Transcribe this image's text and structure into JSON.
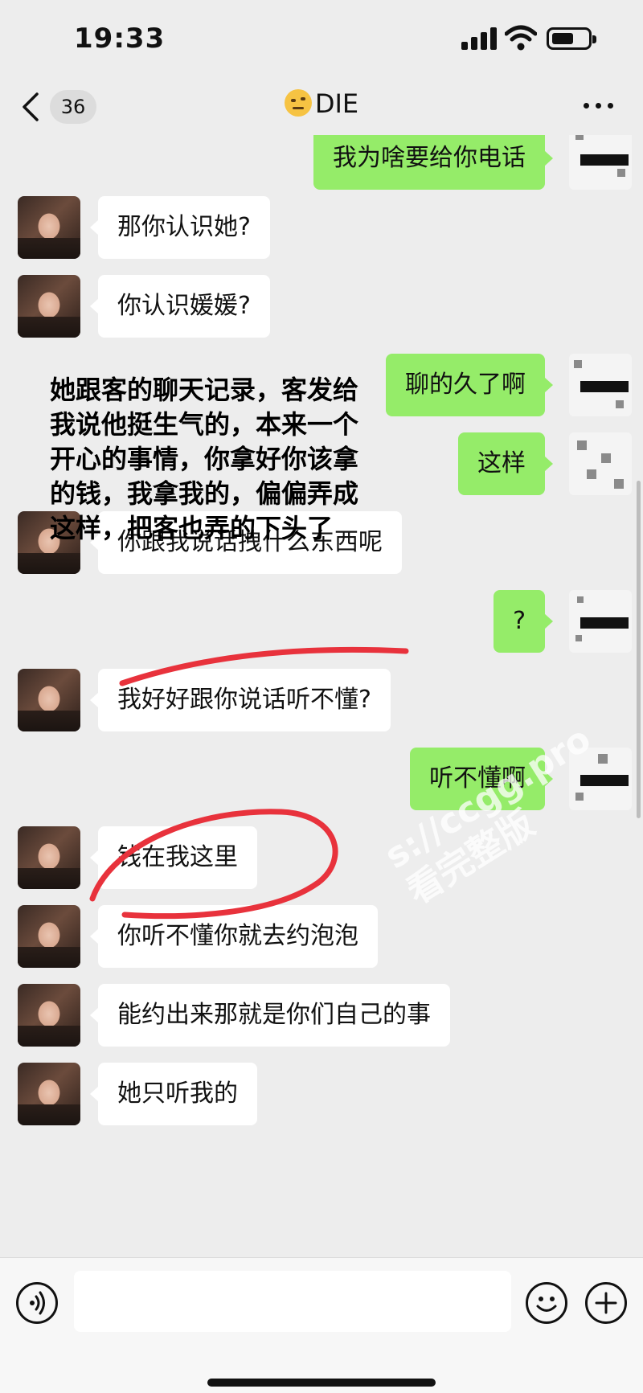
{
  "status_bar": {
    "time": "19:33"
  },
  "nav": {
    "unread_count": "36",
    "title": "DIE"
  },
  "messages": [
    {
      "side": "right",
      "text": "我为啥要给你电话"
    },
    {
      "side": "left",
      "text": "那你认识她?"
    },
    {
      "side": "left",
      "text": "你认识媛媛?"
    },
    {
      "side": "right",
      "text": "聊的久了啊"
    },
    {
      "side": "right",
      "text": "这样"
    },
    {
      "side": "left",
      "text": "你跟我说话拽什么东西呢"
    },
    {
      "side": "right",
      "text": "?"
    },
    {
      "side": "left",
      "text": "我好好跟你说话听不懂?"
    },
    {
      "side": "right",
      "text": "听不懂啊"
    },
    {
      "side": "left",
      "text": "钱在我这里"
    },
    {
      "side": "left",
      "text": "你听不懂你就去约泡泡"
    },
    {
      "side": "left",
      "text": "能约出来那就是你们自己的事"
    },
    {
      "side": "left",
      "text": "她只听我的"
    }
  ],
  "overlay_caption": "她跟客的聊天记录，客发给我说他挺生气的，本来一个开心的事情，你拿好你该拿的钱，我拿我的，偏偏弄成这样，把客也弄的下头了",
  "watermark": {
    "line1": "s://ccgg.pro",
    "line2": "看完整版"
  },
  "icons": {
    "back": "chevron-left-icon",
    "more": "more-dots-icon",
    "voice": "voice-icon",
    "emoji": "emoji-icon",
    "plus": "plus-icon",
    "title_emoji": "raised-eyebrow-face-icon"
  },
  "colors": {
    "background": "#ededed",
    "bubble_left": "#ffffff",
    "bubble_right": "#95ec69",
    "annotation": "#e8323c"
  }
}
